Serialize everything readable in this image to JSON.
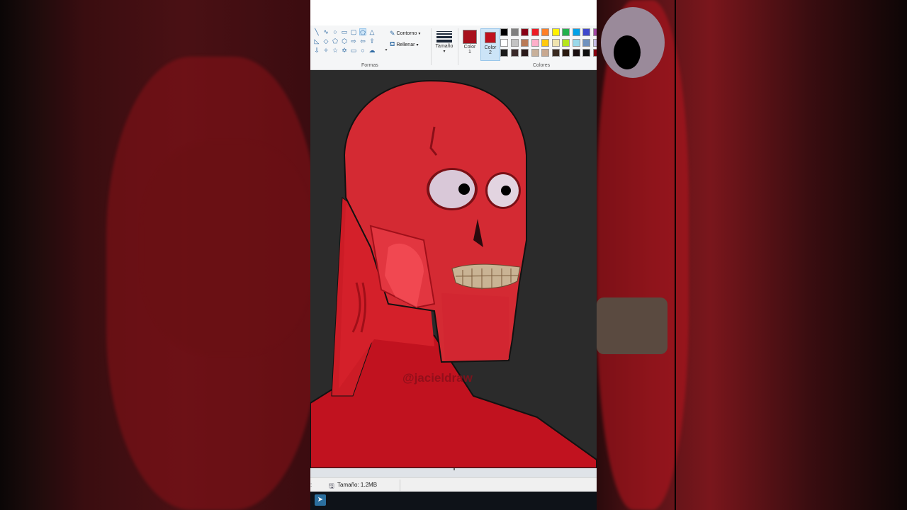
{
  "ribbon": {
    "shapes_group_label": "Formas",
    "outline_label": "Contorno",
    "fill_label": "Rellenar",
    "size_label": "Tamaño",
    "color1_label_top": "Color",
    "color1_label_bottom": "1",
    "color2_label_top": "Color",
    "color2_label_bottom": "2",
    "colors_group_label": "Colores",
    "color1_value": "#a8101c",
    "color2_value": "#c0101e"
  },
  "palette": {
    "row1": [
      "#000000",
      "#7f7f7f",
      "#880015",
      "#ed1c24",
      "#ff7f27",
      "#fff200",
      "#22b14c",
      "#00a2e8",
      "#3f48cc",
      "#a349a4"
    ],
    "row2": [
      "#ffffff",
      "#c3c3c3",
      "#b97a57",
      "#ffaec9",
      "#ffc90e",
      "#efe4b0",
      "#b5e61d",
      "#99d9ea",
      "#7092be",
      "#c8bfe7"
    ],
    "row3": [
      "#1a1a1a",
      "#3a2a2a",
      "#2a1a1a",
      "#c8b09a",
      "#c8a890",
      "#3a2a20",
      "#2a1a10",
      "#1a1010",
      "#101010",
      "#8a0010"
    ]
  },
  "canvas": {
    "watermark": "@jacieldraw"
  },
  "status": {
    "size_text": "Tamaño: 1.2MB"
  }
}
